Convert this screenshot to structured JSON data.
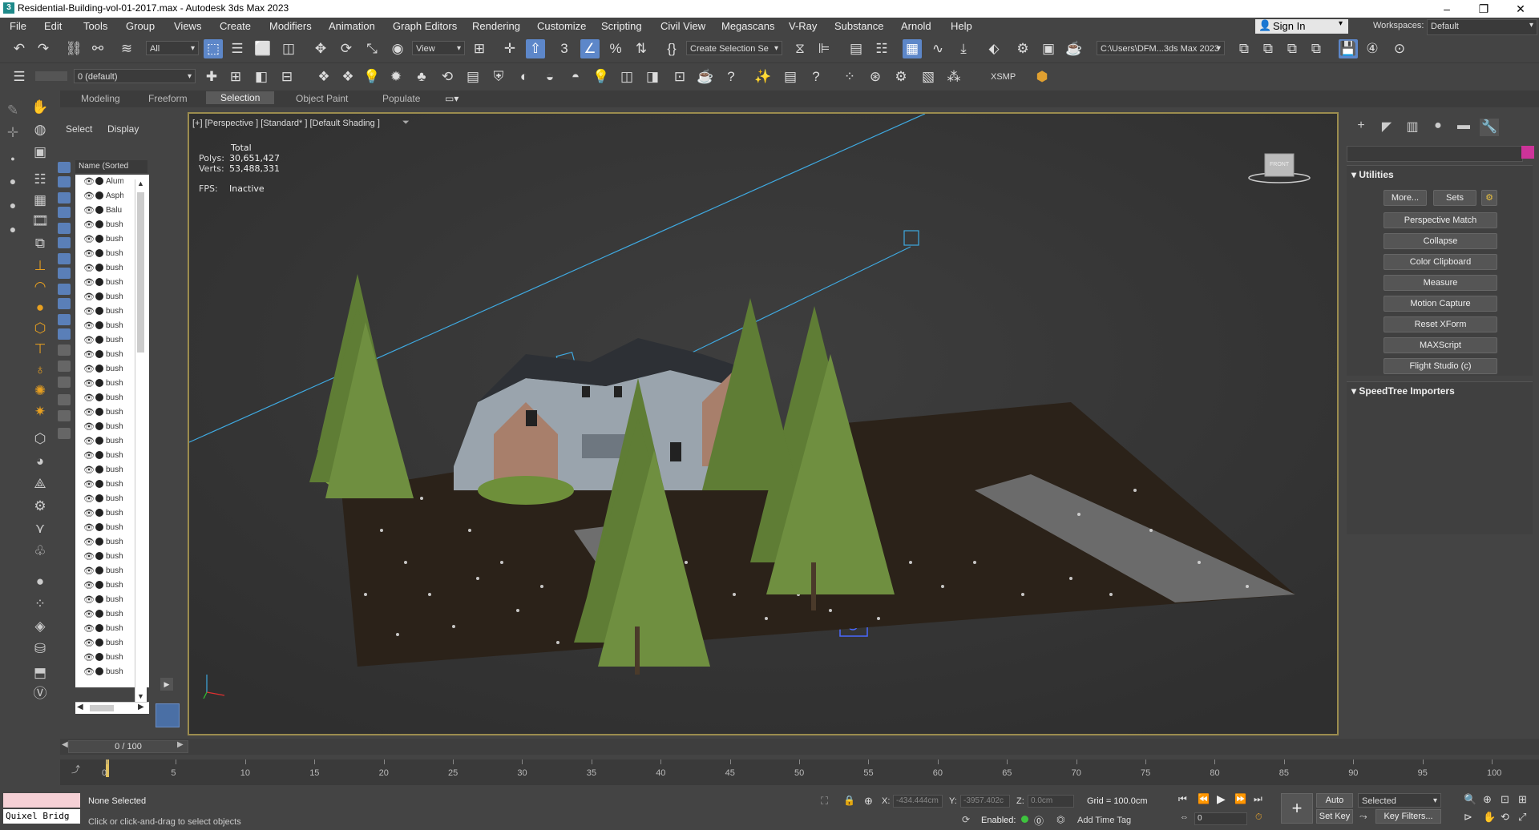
{
  "window": {
    "title": "Residential-Building-vol-01-2017.max - Autodesk 3ds Max 2023",
    "app_icon": "3ds-max-icon",
    "controls": [
      "–",
      "❐",
      "✕"
    ]
  },
  "menu": {
    "items": [
      "File",
      "Edit",
      "Tools",
      "Group",
      "Views",
      "Create",
      "Modifiers",
      "Animation",
      "Graph Editors",
      "Rendering",
      "Customize",
      "Scripting",
      "Civil View",
      "Megascans",
      "V-Ray",
      "Substance",
      "Arnold",
      "Help"
    ],
    "sign_in": "Sign In",
    "workspaces_label": "Workspaces:",
    "workspace_value": "Default"
  },
  "toolbar1": {
    "selection_filter": "All",
    "ref_coord": "View",
    "named_selection": "Create Selection Se",
    "project_path": "C:\\Users\\DFM...3ds Max 2023"
  },
  "toolbar2": {
    "layer": "0 (default)",
    "xsmp_label": "XSMP"
  },
  "ribbon": {
    "tabs": [
      "Modeling",
      "Freeform",
      "Selection",
      "Object Paint",
      "Populate"
    ],
    "active": "Selection"
  },
  "explorer": {
    "tab_select": "Select",
    "tab_display": "Display",
    "column_header": "Name (Sorted Asce",
    "rows": [
      "Alum",
      "Asph",
      "Balu",
      "bush",
      "bush",
      "bush",
      "bush",
      "bush",
      "bush",
      "bush",
      "bush",
      "bush",
      "bush",
      "bush",
      "bush",
      "bush",
      "bush",
      "bush",
      "bush",
      "bush",
      "bush",
      "bush",
      "bush",
      "bush",
      "bush",
      "bush",
      "bush",
      "bush",
      "bush",
      "bush",
      "bush",
      "bush",
      "bush",
      "bush",
      "bush"
    ]
  },
  "viewport": {
    "label": "[+] [Perspective ] [Standard* ] [Default Shading ]",
    "stats": {
      "header": "Total",
      "polys_label": "Polys:",
      "polys": "30,651,427",
      "verts_label": "Verts:",
      "verts": "53,488,331",
      "fps_label": "FPS:",
      "fps": "Inactive"
    },
    "viewcube_label": "FRONT"
  },
  "command_panel": {
    "utilities_title": "Utilities",
    "more_button": "More...",
    "sets_button": "Sets",
    "utilities": [
      "Perspective Match",
      "Collapse",
      "Color Clipboard",
      "Measure",
      "Motion Capture",
      "Reset XForm",
      "MAXScript",
      "Flight Studio (c)"
    ],
    "speedtree_title": "SpeedTree Importers"
  },
  "timeline": {
    "frame_display": "0 / 100",
    "ticks": [
      0,
      5,
      10,
      15,
      20,
      25,
      30,
      35,
      40,
      45,
      50,
      55,
      60,
      65,
      70,
      75,
      80,
      85,
      90,
      95,
      100
    ]
  },
  "status": {
    "quixel": "Quixel Bridg",
    "selection": "None Selected",
    "prompt": "Click or click-and-drag to select objects",
    "x_label": "X:",
    "x_value": "-434.444cm",
    "y_label": "Y:",
    "y_value": "-3957.402c",
    "z_label": "Z:",
    "z_value": "0.0cm",
    "grid": "Grid = 100.0cm",
    "enabled_label": "Enabled:",
    "add_time_tag": "Add Time Tag",
    "auto_key": "Auto Key",
    "set_key": "Set Key",
    "key_mode": "Selected",
    "key_filters": "Key Filters...",
    "frame_field": "0"
  },
  "colors": {
    "accent": "#5d87c9",
    "viewport_border": "#9b8c4e",
    "command_swatch": "#cc3399"
  }
}
